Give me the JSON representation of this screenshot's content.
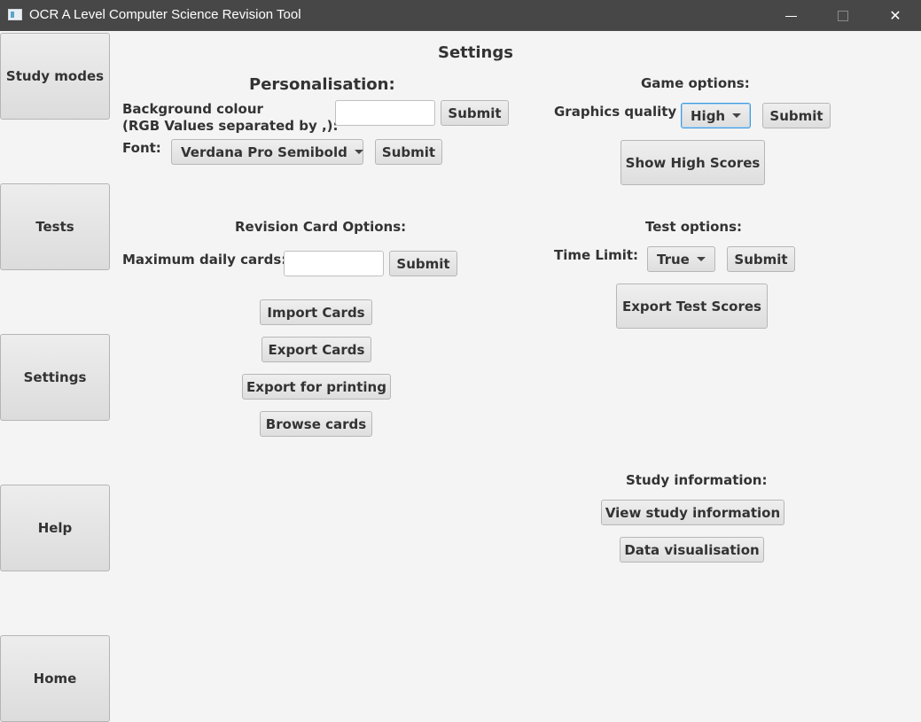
{
  "window": {
    "title": "OCR A Level Computer Science Revision Tool",
    "min_symbol": "",
    "close_symbol": "✕"
  },
  "nav": {
    "study_modes": "Study modes",
    "tests": "Tests",
    "settings": "Settings",
    "help": "Help",
    "home": "Home"
  },
  "page": {
    "title": "Settings"
  },
  "personalisation": {
    "heading": "Personalisation:",
    "bg_label_line1": "Background colour",
    "bg_label_line2": "(RGB Values separated by ,):",
    "bg_value": "",
    "bg_submit": "Submit",
    "font_label": "Font:",
    "font_value": "Verdana Pro Semibold",
    "font_submit": "Submit"
  },
  "game_options": {
    "heading": "Game options:",
    "graphics_label": "Graphics quality",
    "graphics_value": "High",
    "graphics_submit": "Submit",
    "high_scores_button": "Show High Scores"
  },
  "revision_cards": {
    "heading": "Revision Card Options:",
    "max_label": "Maximum daily cards:",
    "max_value": "",
    "max_submit": "Submit",
    "import": "Import Cards",
    "export": "Export Cards",
    "export_print": "Export for printing",
    "browse": "Browse cards"
  },
  "test_options": {
    "heading": "Test options:",
    "time_limit_label": "Time Limit:",
    "time_limit_value": "True",
    "time_limit_submit": "Submit",
    "export_scores": "Export Test Scores"
  },
  "study_info": {
    "heading": "Study information:",
    "view": "View study information",
    "visualise": "Data visualisation"
  },
  "colors": {
    "titlebar": "#474747",
    "background": "#f4f4f4",
    "focus": "#3f9be0"
  }
}
